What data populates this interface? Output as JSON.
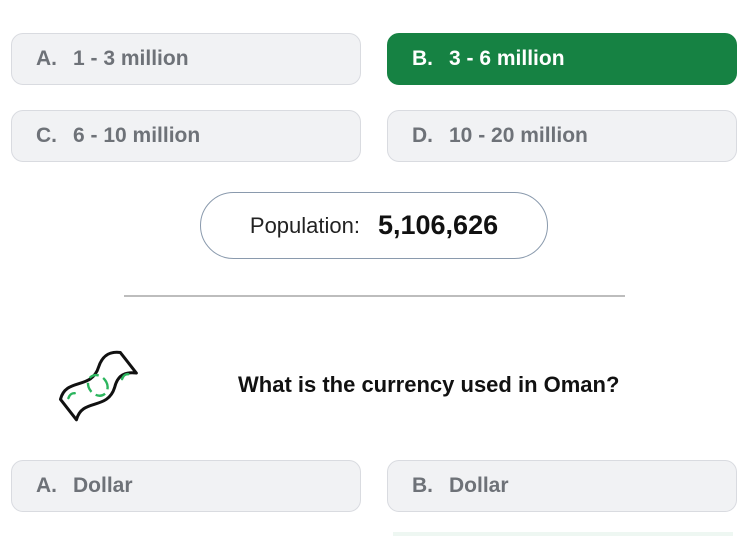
{
  "population_question": {
    "options": [
      {
        "letter": "A.",
        "text": "1 - 3 million"
      },
      {
        "letter": "B.",
        "text": "3 - 6 million"
      },
      {
        "letter": "C.",
        "text": "6 - 10 million"
      },
      {
        "letter": "D.",
        "text": "10 - 20 million"
      }
    ],
    "selected_option": "B"
  },
  "population_badge": {
    "label": "Population:",
    "value": "5,106,626"
  },
  "currency_question": {
    "icon": "money-bill-icon",
    "question": "What is the currency used in Oman?",
    "options": [
      {
        "letter": "A.",
        "text": "Dollar"
      },
      {
        "letter": "B.",
        "text": "Dollar"
      }
    ]
  },
  "colors": {
    "selected_bg": "#168243",
    "option_bg": "#f1f2f4",
    "option_text": "#6e7278",
    "icon_green": "#2cb55e"
  }
}
